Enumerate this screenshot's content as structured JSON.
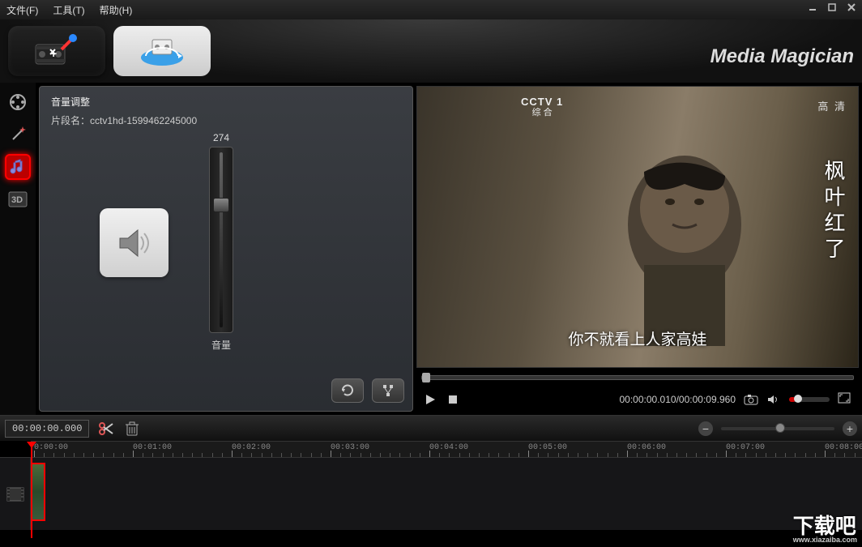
{
  "menubar": {
    "file": "文件(F)",
    "tools": "工具(T)",
    "help": "帮助(H)"
  },
  "brand": "Media Magician",
  "sidebar": {
    "items": [
      {
        "name": "film",
        "label": "视频"
      },
      {
        "name": "effects",
        "label": "特效"
      },
      {
        "name": "audio",
        "label": "音频",
        "selected": true
      },
      {
        "name": "3d",
        "label": "3D"
      }
    ]
  },
  "panel": {
    "title": "音量调整",
    "clip_label_prefix": "片段名：",
    "clip_name": "cctv1hd-1599462245000",
    "volume_value": "274",
    "volume_label": "音量"
  },
  "preview": {
    "channel_logo_top": "CCTV 1",
    "channel_logo_sub": "综 合",
    "quality_badge": "高 清",
    "title_vertical": "枫叶红了",
    "subtitle": "你不就看上人家高娃",
    "time_current": "00:00:00.010",
    "time_total": "00:00:09.960"
  },
  "timeline": {
    "timecode": "00:00:00.000",
    "ruler_marks": [
      "0:00:00",
      "00:01:00",
      "00:02:00",
      "00:03:00",
      "00:04:00",
      "00:05:00",
      "00:06:00",
      "00:07:00",
      "00:08:00"
    ]
  },
  "watermark": {
    "title": "下载吧",
    "url": "www.xiazaiba.com"
  }
}
